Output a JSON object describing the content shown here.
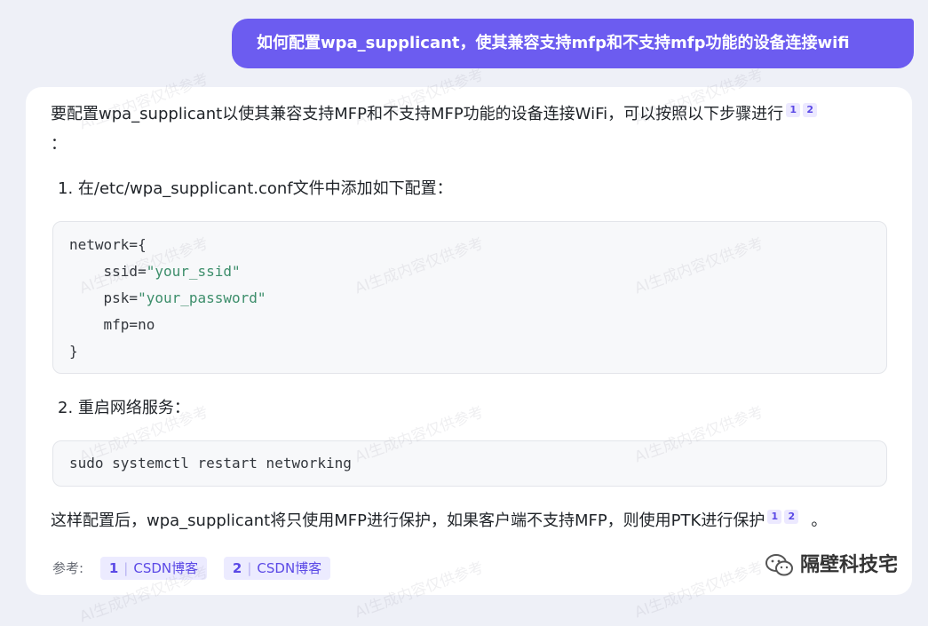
{
  "user_message": "如何配置wpa_supplicant，使其兼容支持mfp和不支持mfp功能的设备连接wifi",
  "answer": {
    "intro": "要配置wpa_supplicant以使其兼容支持MFP和不支持MFP功能的设备连接WiFi，可以按照以下步骤进行",
    "intro_tail": "：",
    "intro_cites": [
      "1",
      "2"
    ],
    "step1": "1. 在/etc/wpa_supplicant.conf文件中添加如下配置：",
    "code1": {
      "l1": "network={",
      "l2a": "    ssid=",
      "l2b": "\"your_ssid\"",
      "l3a": "    psk=",
      "l3b": "\"your_password\"",
      "l4": "    mfp=no",
      "l5": "}"
    },
    "step2": "2. 重启网络服务：",
    "code2": "sudo systemctl restart networking",
    "conclusion": "这样配置后，wpa_supplicant将只使用MFP进行保护，如果客户端不支持MFP，则使用PTK进行保护",
    "conclusion_tail": "。",
    "conclusion_cites": [
      "1",
      "2"
    ],
    "refs_label": "参考:",
    "refs": [
      {
        "num": "1",
        "label": "CSDN博客"
      },
      {
        "num": "2",
        "label": "CSDN博客"
      }
    ]
  },
  "watermark_text": "AI生成内容仅供参考",
  "brand": "隔壁科技宅",
  "colors": {
    "accent": "#6c5cf0",
    "string": "#3d8e6b",
    "background": "#eef0f7"
  }
}
